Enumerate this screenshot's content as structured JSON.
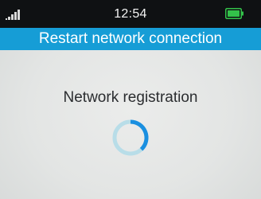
{
  "status_bar": {
    "time": "12:54",
    "signal_icon": "signal-bars-icon",
    "battery_icon": "battery-full-icon",
    "battery_color": "#33c24a"
  },
  "header": {
    "title": "Restart network connection",
    "background_color": "#169dd6"
  },
  "main": {
    "message": "Network registration",
    "spinner_icon": "loading-spinner-icon",
    "spinner_color": "#1a8fe0"
  }
}
